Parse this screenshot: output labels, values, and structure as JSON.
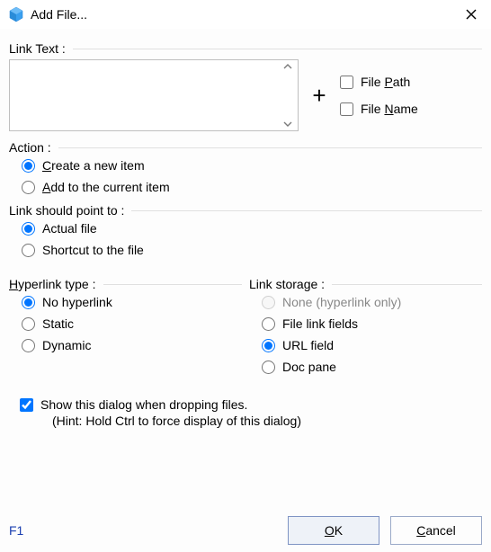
{
  "title": "Add File...",
  "sections": {
    "link_text_label": "Link Text :",
    "link_text_value": "",
    "plus": "+",
    "file_path_label": "File Path",
    "file_path_checked": false,
    "file_name_label": "File Name",
    "file_name_checked": false,
    "action_label": "Action :",
    "action_options": {
      "create": "Create a new item",
      "add": "Add to the current item"
    },
    "action_selected": "create",
    "point_label": "Link should point to :",
    "point_options": {
      "actual": "Actual file",
      "shortcut": "Shortcut to the file"
    },
    "point_selected": "actual",
    "hyper_label": "Hyperlink type :",
    "hyper_options": {
      "none": "No hyperlink",
      "static": "Static",
      "dynamic": "Dynamic"
    },
    "hyper_selected": "none",
    "storage_label": "Link storage :",
    "storage_options": {
      "none": "None (hyperlink only)",
      "fields": "File link fields",
      "url": "URL field",
      "doc": "Doc pane"
    },
    "storage_selected": "url",
    "storage_none_disabled": true,
    "show_dialog_label": "Show this dialog when dropping files.",
    "show_dialog_checked": true,
    "hint": "(Hint: Hold Ctrl to force display of this dialog)"
  },
  "footer": {
    "help": "F1",
    "ok": "OK",
    "cancel": "Cancel"
  }
}
